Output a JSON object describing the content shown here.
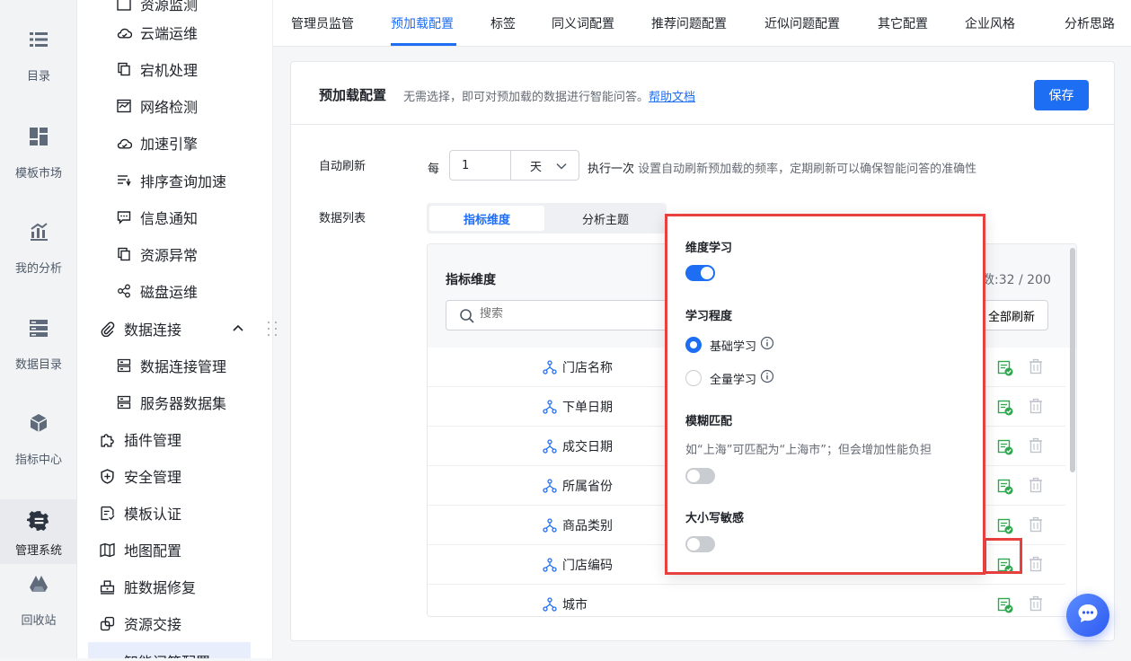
{
  "rail": [
    {
      "label": "目录",
      "icon": "catalog-icon"
    },
    {
      "label": "模板市场",
      "icon": "template-market-icon"
    },
    {
      "label": "我的分析",
      "icon": "analysis-icon"
    },
    {
      "label": "数据目录",
      "icon": "data-catalog-icon"
    },
    {
      "label": "指标中心",
      "icon": "metrics-center-icon"
    },
    {
      "label": "管理系统",
      "icon": "management-system-icon",
      "active": true
    },
    {
      "label": "回收站",
      "icon": "recycle-bin-icon"
    }
  ],
  "nav": {
    "partial_top": "资源监测",
    "sub_items": [
      "云端运维",
      "宕机处理",
      "网络检测",
      "加速引擎",
      "排序查询加速",
      "信息通知",
      "资源异常",
      "磁盘运维"
    ],
    "data_connection": {
      "label": "数据连接",
      "children": [
        "数据连接管理",
        "服务器数据集"
      ]
    },
    "top_items": [
      "插件管理",
      "安全管理",
      "模板认证",
      "地图配置",
      "脏数据修复",
      "资源交接"
    ],
    "partial_bottom": "智能问答配置"
  },
  "tabs": [
    "管理员监管",
    "预加载配置",
    "标签",
    "同义词配置",
    "推荐问题配置",
    "近似问题配置",
    "其它配置",
    "企业风格",
    "分析思路"
  ],
  "active_tab": "预加载配置",
  "card": {
    "title": "预加载配置",
    "desc": "无需选择，即可对预加载的数据进行智能问答。",
    "help_link": "帮助文档",
    "save_label": "保存"
  },
  "auto_refresh": {
    "label": "自动刷新",
    "prefix": "每",
    "value": "1",
    "unit": "天",
    "suffix": "执行一次",
    "hint": "设置自动刷新预加载的频率，定期刷新可以确保智能问答的准确性"
  },
  "data_list": {
    "label": "数据列表",
    "segments": [
      "指标维度",
      "分析主题"
    ],
    "active_segment": "指标维度",
    "panel_title": "指标维度",
    "count_text": "数:32 / 200",
    "search_placeholder": "搜索",
    "refresh_all_label": "全部刷新",
    "rows": [
      "门店名称",
      "下单日期",
      "成交日期",
      "所属省份",
      "商品类别",
      "门店编码",
      "城市"
    ]
  },
  "popover": {
    "dim_learning_title": "维度学习",
    "dim_learning_on": true,
    "level_title": "学习程度",
    "level_options": [
      "基础学习",
      "全量学习"
    ],
    "level_selected": "基础学习",
    "fuzzy_title": "模糊匹配",
    "fuzzy_desc": "如“上海”可匹配为“上海市”；但会增加性能负担",
    "fuzzy_on": false,
    "case_title": "大小写敏感",
    "case_on": false
  },
  "colors": {
    "accent": "#1e6ef4",
    "highlight": "#e8403f",
    "config_icon": "#2ea84f"
  }
}
